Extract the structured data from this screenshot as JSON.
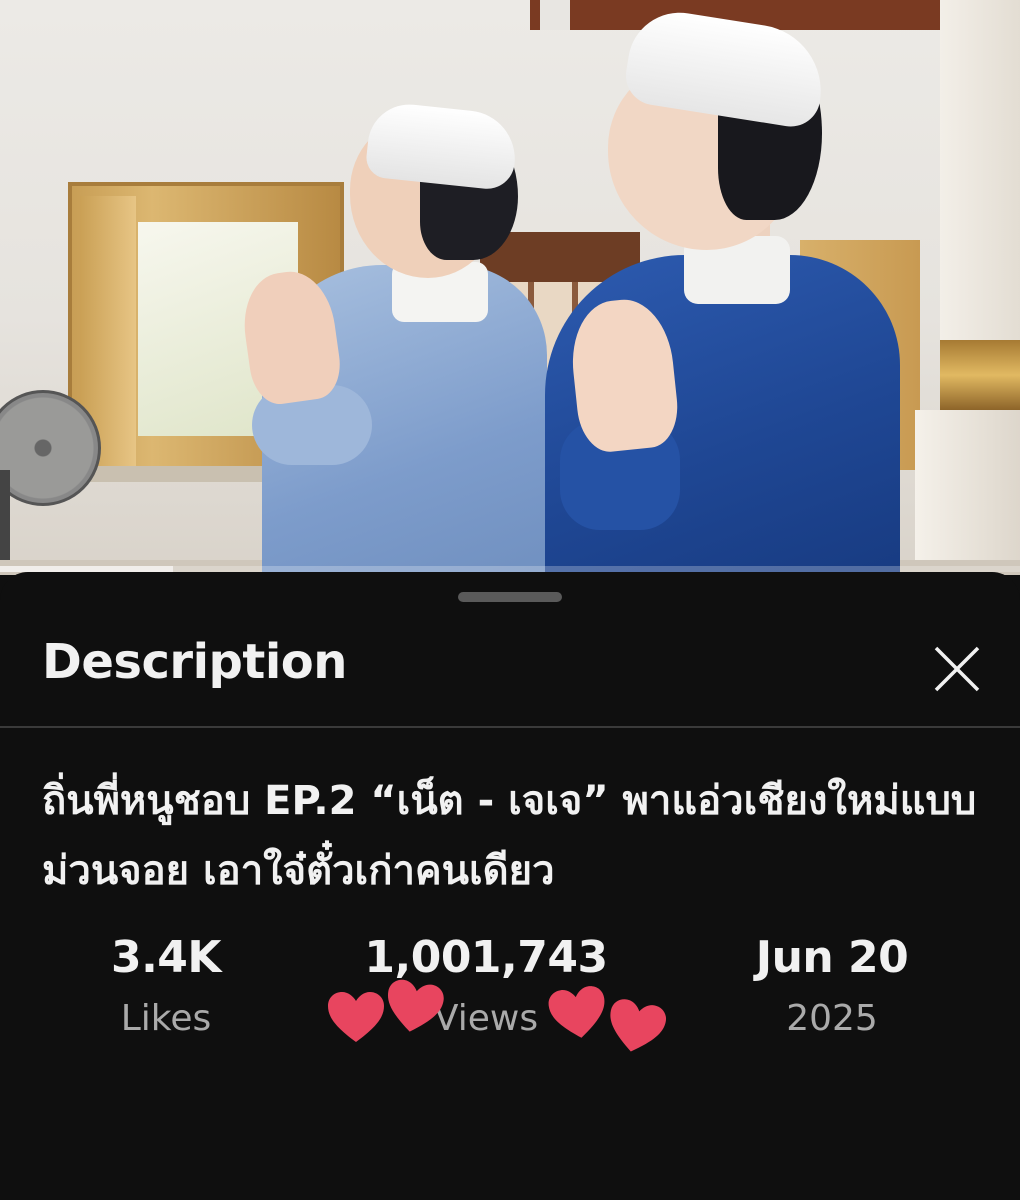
{
  "video": {
    "progress_fraction": 0.17
  },
  "description_panel": {
    "title": "Description",
    "close_icon": "close-icon",
    "video_title": "ถิ่นพี่หนูชอบ EP.2 “เน็ต - เจเจ” พาแอ่วเชียงใหม่แบบม่วนจอย เอาใจ๋ตั๋วเก่าคนเดียว",
    "stats": {
      "likes": {
        "value": "3.4K",
        "label": "Likes"
      },
      "views": {
        "value": "1,001,743",
        "label": "Views"
      },
      "date": {
        "value": "Jun 20",
        "label": "2025"
      }
    }
  },
  "colors": {
    "background": "#0f0f0f",
    "text_primary": "#f1f1f1",
    "text_secondary": "#aaaaaa",
    "heart": "#e8455f"
  },
  "decorations": {
    "heart_icons": [
      "heart-icon",
      "heart-icon",
      "heart-icon",
      "heart-icon"
    ]
  }
}
